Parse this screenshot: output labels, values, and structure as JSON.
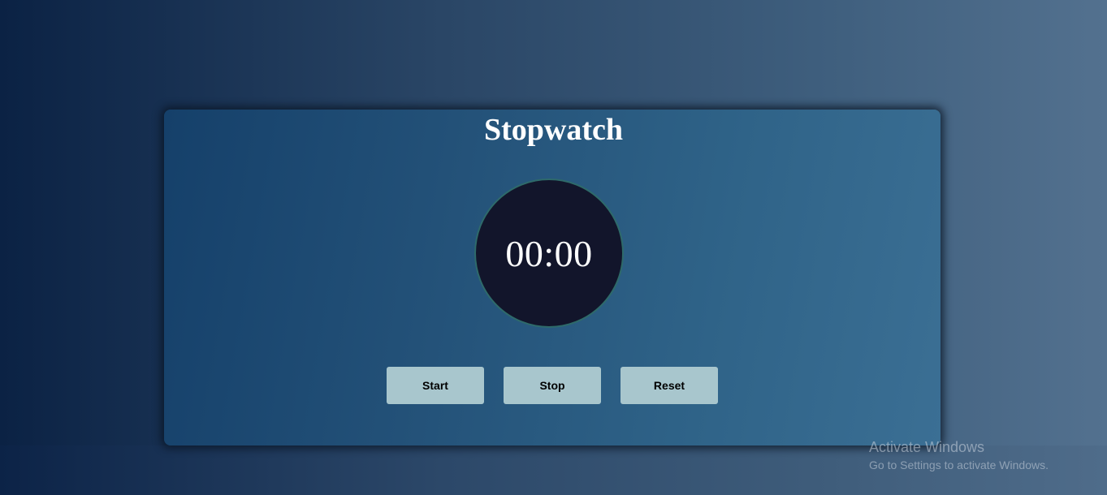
{
  "app": {
    "title": "Stopwatch"
  },
  "display": {
    "time": "00:00"
  },
  "controls": {
    "start_label": "Start",
    "stop_label": "Stop",
    "reset_label": "Reset"
  },
  "watermark": {
    "title": "Activate Windows",
    "subtitle": "Go to Settings to activate Windows."
  },
  "colors": {
    "button_bg": "#a8c6cd",
    "dial_bg": "#12152b",
    "text": "#ffffff"
  }
}
